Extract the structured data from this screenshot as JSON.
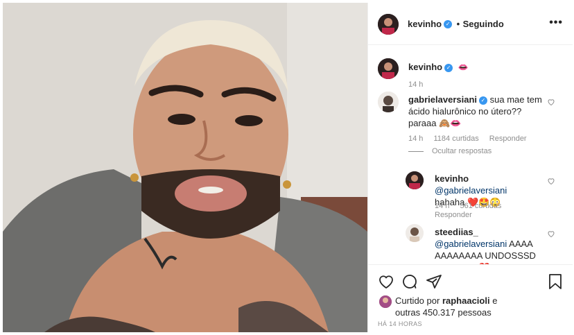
{
  "header": {
    "username": "kevinho",
    "dot": "•",
    "follow_status": "Seguindo",
    "more": "•••"
  },
  "caption": {
    "username": "kevinho",
    "emoji": "👄",
    "time": "14 h"
  },
  "comments": [
    {
      "username": "gabrielaversiani",
      "text": "sua mae tem ácido hialurônico no útero?? paraaa 🙈👄",
      "time": "14 h",
      "likes": "1184 curtidas",
      "reply": "Responder",
      "hide_replies": "Ocultar respostas"
    }
  ],
  "replies": [
    {
      "username": "kevinho",
      "mention": "@gabrielaversiani",
      "text": "hahaha ❤️🤩😳",
      "time": "14 h",
      "likes": "561 curtidas",
      "reply": "Responder"
    },
    {
      "username": "steediias_",
      "mention": "@gabrielaversiani",
      "text": "AAAAAAAAAAAA UNDOSSSD AMOOOO ❤️"
    }
  ],
  "liked_by": {
    "prefix": "Curtido por",
    "user": "raphaacioli",
    "suffix": "e",
    "others": "outras 450.317 pessoas"
  },
  "timestamp": "HÁ 14 HORAS",
  "colors": {
    "verified": "#3897f0",
    "muted": "#8e8e8e",
    "border": "#efefef"
  }
}
